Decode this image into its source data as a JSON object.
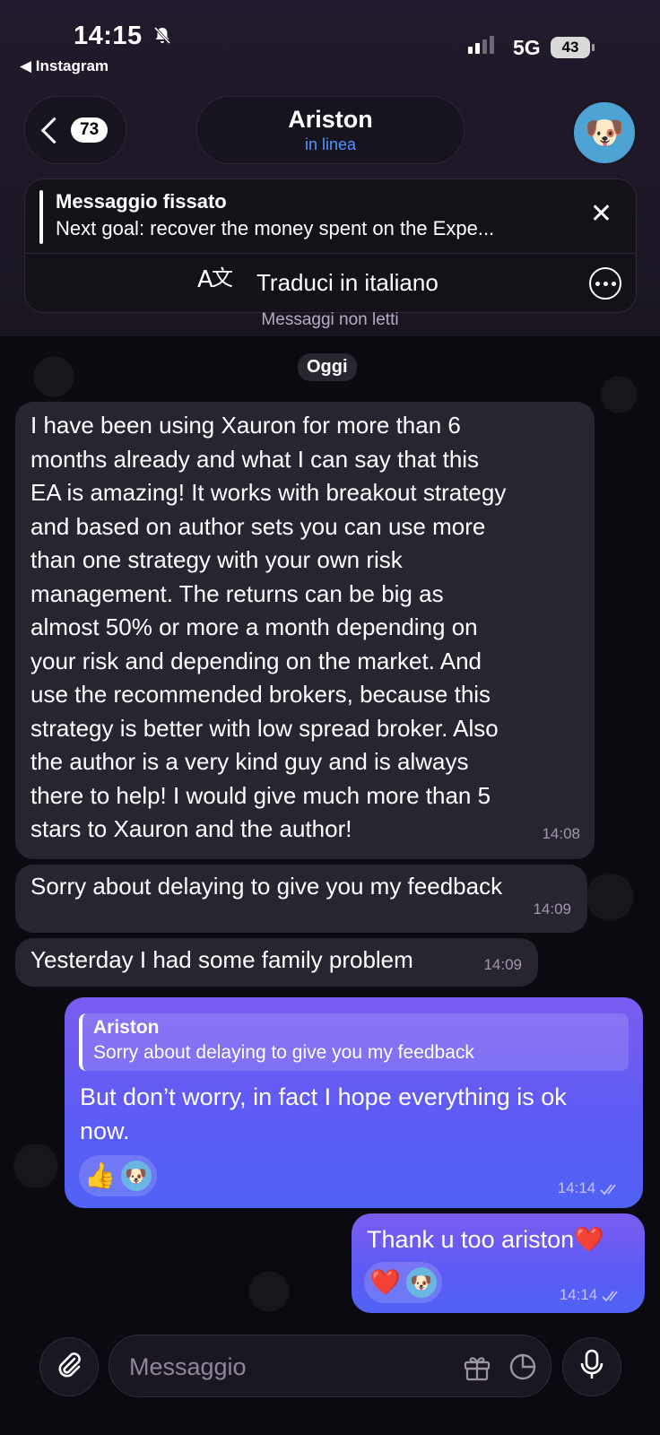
{
  "status_bar": {
    "time": "14:15",
    "back_app": "◀ Instagram",
    "network": "5G",
    "battery": "43"
  },
  "header": {
    "back_count": "73",
    "name": "Ariston",
    "status": "in linea"
  },
  "pinned": {
    "title": "Messaggio fissato",
    "text": "Next goal: recover the money spent on the Expe...",
    "translate_label": "Traduci in italiano"
  },
  "unread_label": "Messaggi non letti",
  "date_chip": "Oggi",
  "messages": [
    {
      "direction": "in",
      "lines": [
        "I have been using Xauron for more than 6",
        "months already and what I can say that this",
        "EA is amazing! It works with breakout strategy",
        "and based on author sets you can use more",
        "than one strategy with your own risk",
        "management. The returns can be big as",
        "almost 50% or more a month depending on",
        "your risk and depending on the market. And",
        "use the recommended brokers, because this",
        "strategy is better with low spread broker. Also",
        "the author is a very kind guy and is always",
        "there to help! I would give much more than 5",
        "stars to Xauron and the author!"
      ],
      "time": "14:08"
    },
    {
      "direction": "in",
      "text": "Sorry about delaying to give you my feedback",
      "time": "14:09"
    },
    {
      "direction": "in",
      "text": "Yesterday I had some family problem",
      "time": "14:09"
    },
    {
      "direction": "out",
      "reply_to": {
        "name": "Ariston",
        "text": "Sorry about delaying to give you my feedback"
      },
      "lines": [
        "But don’t worry, in fact I hope everything is ok",
        "now."
      ],
      "reaction_emoji": "👍",
      "time": "14:14"
    },
    {
      "direction": "out",
      "text": "Thank u too ariston❤️",
      "reaction_emoji": "❤️",
      "time": "14:14"
    }
  ],
  "composer": {
    "placeholder": "Messaggio"
  },
  "colors": {
    "accent_blue": "#4e96ff",
    "outgoing_bubble_top": "#7b5cf0",
    "outgoing_bubble_bottom": "#4f63f4",
    "incoming_bubble": "#282430"
  }
}
